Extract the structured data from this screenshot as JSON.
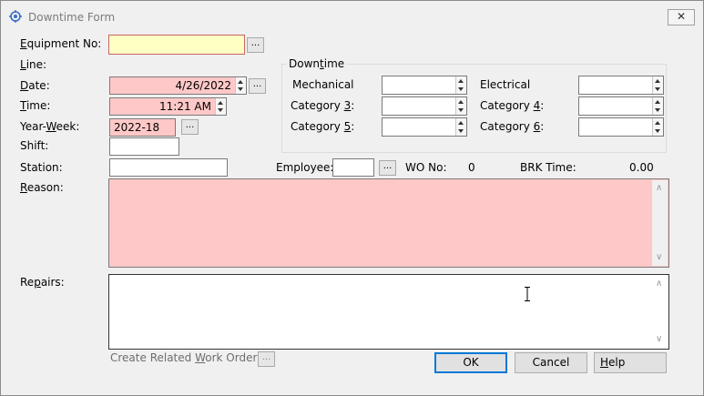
{
  "window": {
    "title": "Downtime Form",
    "close_glyph": "✕",
    "accent": "#0078d7"
  },
  "fields": {
    "equipment_no": {
      "label_pre": "",
      "label_key": "E",
      "label_post": "quipment No:",
      "value": ""
    },
    "line": {
      "label_pre": "",
      "label_key": "L",
      "label_post": "ine:"
    },
    "date": {
      "label_pre": "",
      "label_key": "D",
      "label_post": "ate:",
      "value": "4/26/2022"
    },
    "time": {
      "label_pre": "",
      "label_key": "T",
      "label_post": "ime:",
      "value": "11:21 AM"
    },
    "year_week": {
      "label_pre": "Year-",
      "label_key": "W",
      "label_post": "eek:",
      "value": "2022-18"
    },
    "shift": {
      "label": "Shift:",
      "value": ""
    },
    "station": {
      "label": "Station:",
      "value": ""
    },
    "employee": {
      "label": "Employee:",
      "value": ""
    },
    "wo_no": {
      "label": "WO No:",
      "value": "0"
    },
    "brk_time": {
      "label": "BRK Time:",
      "value": "0.00"
    },
    "reason": {
      "label_pre": "",
      "label_key": "R",
      "label_post": "eason:",
      "value": ""
    },
    "repairs": {
      "label_pre": "Re",
      "label_key": "p",
      "label_post": "airs:",
      "value": ""
    }
  },
  "downtime": {
    "title_pre": "Down",
    "title_key": "t",
    "title_post": "ime",
    "mechanical": {
      "label": "Mechanical",
      "value": ""
    },
    "electrical": {
      "label": "Electrical",
      "value": ""
    },
    "category3": {
      "label_pre": "Category ",
      "label_key": "3",
      "label_post": ":",
      "value": ""
    },
    "category4": {
      "label_pre": "Category ",
      "label_key": "4",
      "label_post": ":",
      "value": ""
    },
    "category5": {
      "label_pre": "Category ",
      "label_key": "5",
      "label_post": ":",
      "value": ""
    },
    "category6": {
      "label_pre": "Category ",
      "label_key": "6",
      "label_post": ":",
      "value": ""
    }
  },
  "footer": {
    "create_wo_pre": "Create Related ",
    "create_wo_key": "W",
    "create_wo_post": "ork Order",
    "ellipsis": "...",
    "ok": "OK",
    "cancel": "Cancel",
    "help_key": "H",
    "help_post": "elp"
  },
  "ellipsis": "...",
  "colors": {
    "required_bg": "#ffc8c8",
    "focus_bg": "#ffffc4",
    "dialog_bg": "#f0f0f0"
  }
}
